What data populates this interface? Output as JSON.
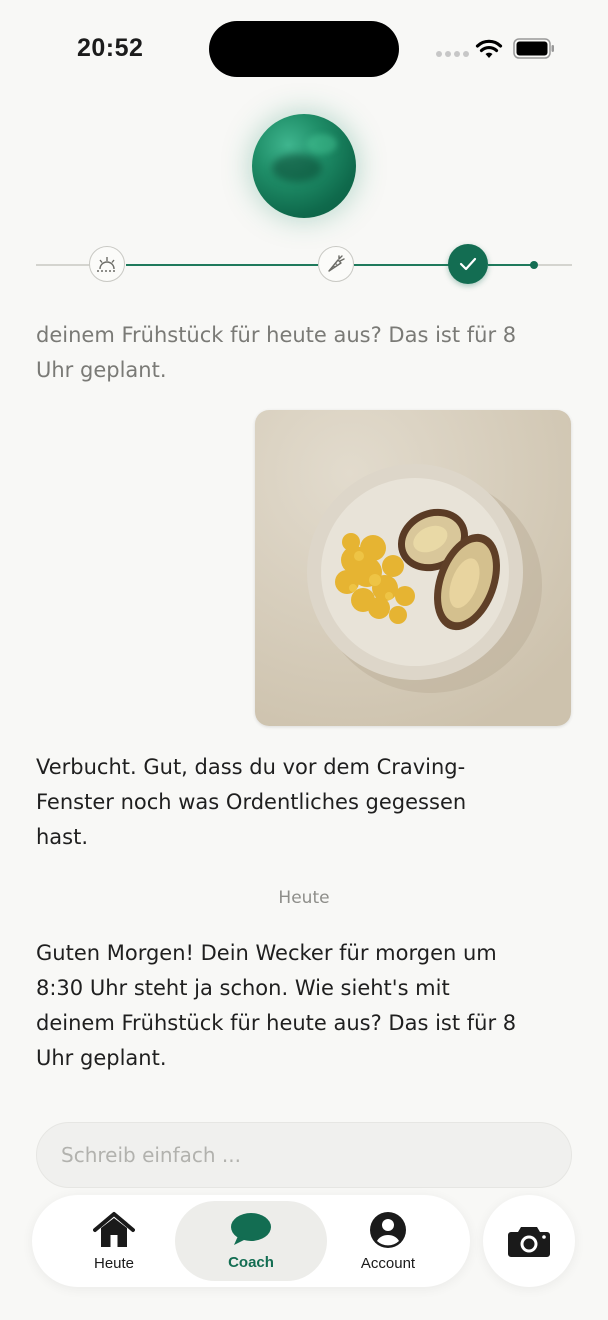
{
  "status": {
    "time": "20:52"
  },
  "chat": {
    "faded_message": "deinem Frühstück für heute aus? Das ist für 8\nUhr geplant.",
    "reply_message": "Verbucht. Gut, dass du vor dem Craving-\nFenster noch was Ordentliches gegessen\nhast.",
    "date_separator": "Heute",
    "morning_message": "Guten Morgen! Dein Wecker für morgen um\n8:30 Uhr steht ja schon. Wie sieht's mit\ndeinem Frühstück für heute aus? Das ist für 8\nUhr geplant."
  },
  "timeline": {
    "steps": [
      "sunrise-icon",
      "carrot-icon",
      "check-icon"
    ],
    "accent": "#136d52"
  },
  "composer": {
    "placeholder": "Schreib einfach ..."
  },
  "tabbar": {
    "tabs": [
      {
        "label": "Heute",
        "icon": "home-icon",
        "active": false
      },
      {
        "label": "Coach",
        "icon": "chat-bubble-icon",
        "active": true
      },
      {
        "label": "Account",
        "icon": "user-icon",
        "active": false
      }
    ],
    "camera_icon": "camera-icon"
  },
  "colors": {
    "accent": "#136d52",
    "background": "#f8f8f6"
  }
}
